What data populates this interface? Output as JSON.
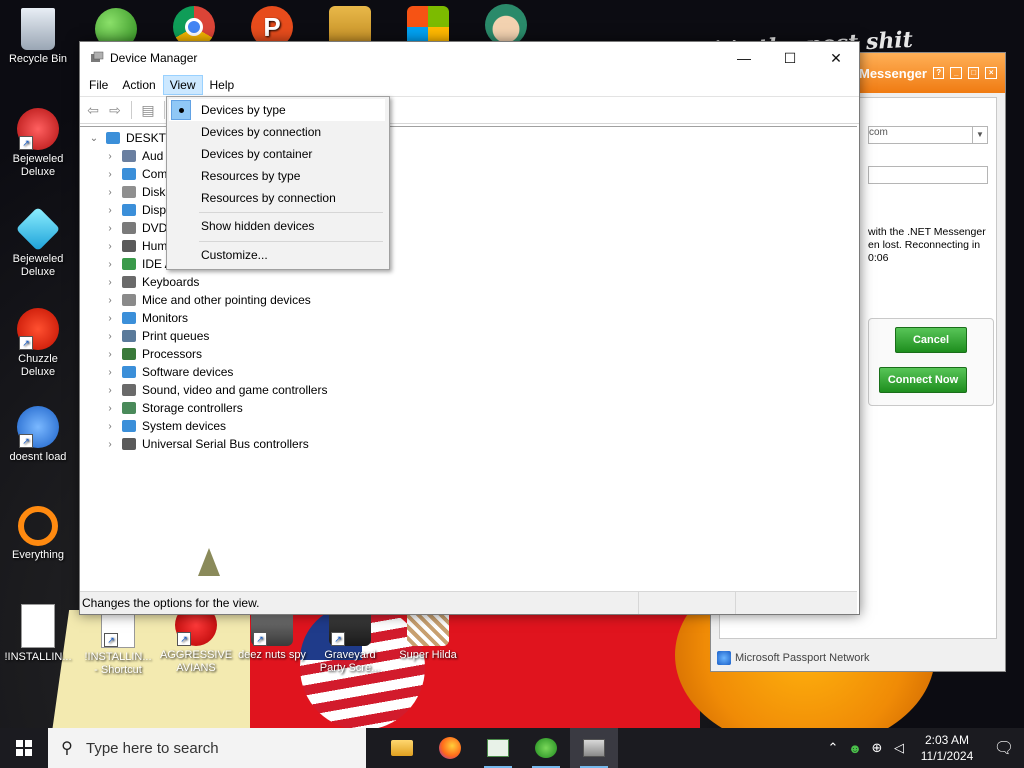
{
  "desktop": {
    "graffiti": "...it's the post shit",
    "icons": [
      {
        "label": "Recycle Bin",
        "icon": "recycle-bin-icon"
      },
      {
        "label": "Bejeweled Deluxe",
        "icon": "bejeweled-icon"
      },
      {
        "label": "Bejeweled Deluxe",
        "icon": "bejeweled-gem-icon"
      },
      {
        "label": "Chuzzle Deluxe",
        "icon": "chuzzle-icon"
      },
      {
        "label": "doesnt load",
        "icon": "bird-icon"
      },
      {
        "label": "Everything",
        "icon": "everything-search-icon"
      },
      {
        "label": "!INSTALLIN...",
        "icon": "text-file-icon"
      },
      {
        "label": "!INSTALLIN... - Shortcut",
        "icon": "text-file-shortcut-icon"
      },
      {
        "label": "AGGRESSIVE AVIANS",
        "icon": "angry-bird-icon"
      },
      {
        "label": "deez nuts spy",
        "icon": "app-icon"
      },
      {
        "label": "Graveyard Party Scre...",
        "icon": "graveyard-icon"
      },
      {
        "label": "Super Hilda",
        "icon": "hilda-icon"
      }
    ],
    "top_icons": [
      "people-icon",
      "chrome-icon",
      "p-icon",
      "folder-icon",
      "windows-flag-icon",
      "anime-icon"
    ]
  },
  "messenger": {
    "title": "Messenger",
    "combo_value": "com",
    "message": "with the .NET Messenger en lost. Reconnecting in",
    "countdown": "0:06",
    "cancel_label": "Cancel",
    "connect_label": "Connect Now",
    "footer": "Microsoft Passport Network"
  },
  "device_manager": {
    "title": "Device Manager",
    "menu": [
      "File",
      "Action",
      "View",
      "Help"
    ],
    "active_menu": "View",
    "tree_root": "DESKTO",
    "nodes": [
      {
        "label": "Aud",
        "icon": "audio-icon",
        "color": "#6a7fa0"
      },
      {
        "label": "Com",
        "icon": "computer-icon",
        "color": "#3b8fd9"
      },
      {
        "label": "Disk",
        "icon": "disk-icon",
        "color": "#8f8f8f"
      },
      {
        "label": "Disp",
        "icon": "display-icon",
        "color": "#3b8fd9"
      },
      {
        "label": "DVD",
        "icon": "dvd-icon",
        "color": "#7a7a7a"
      },
      {
        "label": "Hum",
        "icon": "keyboard-icon",
        "color": "#5a5a5a"
      },
      {
        "label": "IDE A",
        "icon": "ide-icon",
        "color": "#3a9a4a"
      },
      {
        "label": "Keyboards",
        "icon": "keyboard-icon",
        "color": "#6a6a6a"
      },
      {
        "label": "Mice and other pointing devices",
        "icon": "mouse-icon",
        "color": "#8a8a8a"
      },
      {
        "label": "Monitors",
        "icon": "monitor-icon",
        "color": "#3b8fd9"
      },
      {
        "label": "Print queues",
        "icon": "printer-icon",
        "color": "#5a7a9a"
      },
      {
        "label": "Processors",
        "icon": "processor-icon",
        "color": "#3a7a3a"
      },
      {
        "label": "Software devices",
        "icon": "software-device-icon",
        "color": "#3b8fd9"
      },
      {
        "label": "Sound, video and game controllers",
        "icon": "speaker-icon",
        "color": "#6a6a6a"
      },
      {
        "label": "Storage controllers",
        "icon": "storage-icon",
        "color": "#4a8a5a"
      },
      {
        "label": "System devices",
        "icon": "system-icon",
        "color": "#3b8fd9"
      },
      {
        "label": "Universal Serial Bus controllers",
        "icon": "usb-icon",
        "color": "#5a5a5a"
      }
    ],
    "status": "Changes the options for the view."
  },
  "view_menu": {
    "items": [
      {
        "label": "Devices by type",
        "checked": true
      },
      {
        "label": "Devices by connection",
        "checked": false
      },
      {
        "label": "Devices by container",
        "checked": false
      },
      {
        "label": "Resources by type",
        "checked": false
      },
      {
        "label": "Resources by connection",
        "checked": false
      },
      {
        "label": "Show hidden devices",
        "checked": false
      },
      {
        "label": "Customize...",
        "checked": false
      }
    ]
  },
  "taskbar": {
    "search_placeholder": "Type here to search",
    "apps": [
      "file-explorer-icon",
      "firefox-icon",
      "window-app-icon",
      "people-icon",
      "device-manager-icon"
    ],
    "time": "2:03 AM",
    "date": "11/1/2024"
  }
}
